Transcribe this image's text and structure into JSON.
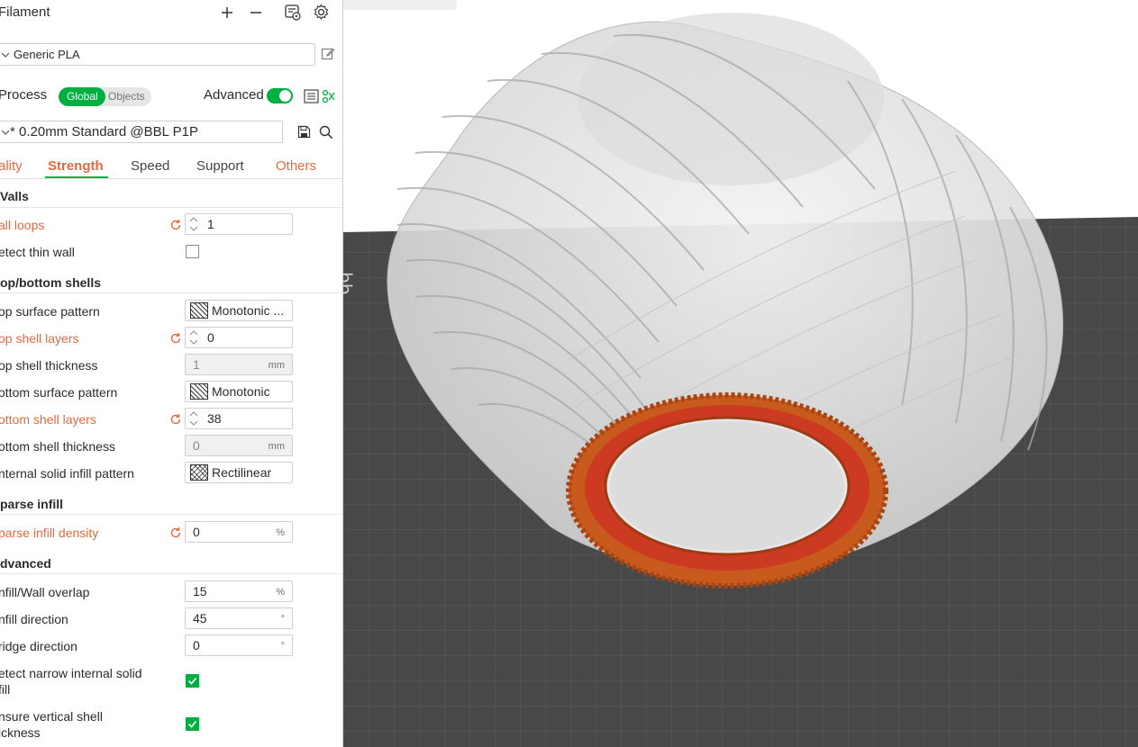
{
  "filament": {
    "title": "Filament",
    "add_icon": "plus-icon",
    "remove_icon": "minus-icon",
    "preset": "Generic PLA"
  },
  "process": {
    "title": "Process",
    "toggle_global": "Global",
    "toggle_objects": "Objects",
    "advanced_label": "Advanced",
    "advanced_on": true,
    "preset": "* 0.20mm Standard @BBL P1P"
  },
  "tabs": [
    {
      "label": "ality"
    },
    {
      "label": "Strength"
    },
    {
      "label": "Speed"
    },
    {
      "label": "Support"
    },
    {
      "label": "Others"
    }
  ],
  "sections": {
    "walls": "Valls",
    "top_bottom": "op/bottom shells",
    "sparse": "parse infill",
    "advanced": "dvanced"
  },
  "settings": {
    "wall_loops": {
      "label": "all loops",
      "value": "1"
    },
    "detect_thin_wall": {
      "label": "etect thin wall",
      "checked": false
    },
    "top_surface_pattern": {
      "label": "op surface pattern",
      "value": "Monotonic ..."
    },
    "top_shell_layers": {
      "label": "op shell layers",
      "value": "0"
    },
    "top_shell_thickness": {
      "label": "op shell thickness",
      "value": "1",
      "unit": "mm"
    },
    "bottom_surface_pattern": {
      "label": "ottom surface pattern",
      "value": "Monotonic"
    },
    "bottom_shell_layers": {
      "label": "ottom shell layers",
      "value": "38"
    },
    "bottom_shell_thickness": {
      "label": "ottom shell thickness",
      "value": "0",
      "unit": "mm"
    },
    "internal_solid_infill_pattern": {
      "label": "nternal solid infill pattern",
      "value": "Rectilinear"
    },
    "sparse_infill_density": {
      "label": "parse infill density",
      "value": "0",
      "unit": "%"
    },
    "infill_wall_overlap": {
      "label": "nfill/Wall overlap",
      "value": "15",
      "unit": "%"
    },
    "infill_direction": {
      "label": "nfill direction",
      "value": "45",
      "unit": "°"
    },
    "bridge_direction": {
      "label": "ridge direction",
      "value": "0",
      "unit": "°"
    },
    "detect_narrow_solid_infill": {
      "label_line1": "etect narrow internal solid",
      "label_line2": "fill",
      "checked": true
    },
    "ensure_vertical_shell": {
      "label_line1": "nsure vertical shell",
      "label_line2": "ickness",
      "checked": true
    }
  },
  "colors": {
    "accent": "#00ae42",
    "modified": "#e06a3f",
    "plate": "#484848",
    "part": "#c85a1e"
  }
}
